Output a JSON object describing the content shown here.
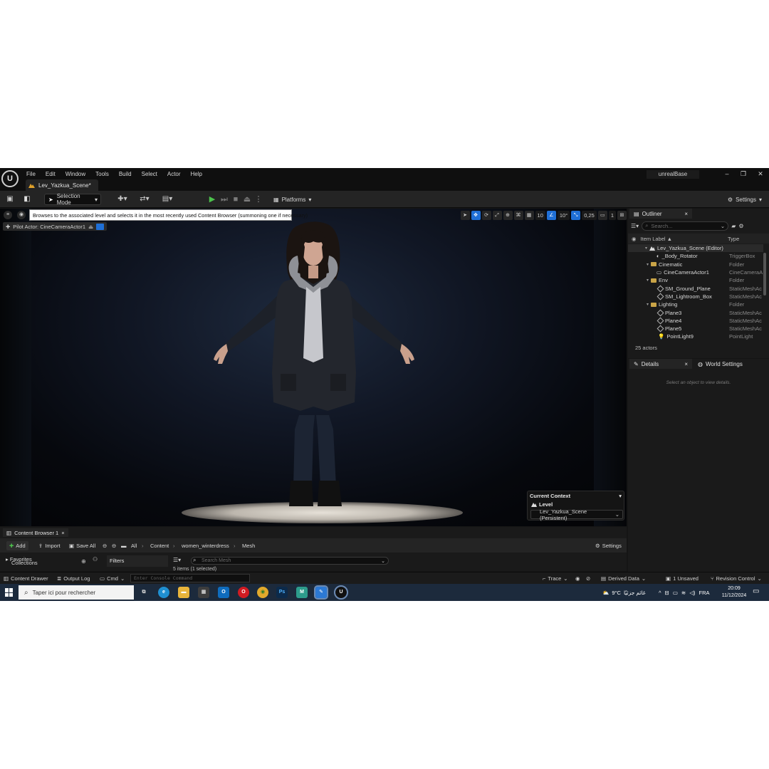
{
  "menu": {
    "items": [
      "File",
      "Edit",
      "Window",
      "Tools",
      "Build",
      "Select",
      "Actor",
      "Help"
    ],
    "doc_tab": "Lev_Yazkua_Scene*",
    "project": "unrealBase"
  },
  "toolbar": {
    "mode": "Selection Mode",
    "platforms": "Platforms",
    "settings": "Settings"
  },
  "viewport": {
    "tooltip": "Browses to the associated level and selects it in the most recently used Content Browser (summoning one if necessary)",
    "pilot": "Pilot Actor: CineCameraActor1",
    "grid_snap": "10",
    "rot_snap": "10°",
    "scale_snap": "0,25",
    "cam_speed": "1"
  },
  "context": {
    "title": "Current Context",
    "level_label": "Level",
    "level_value": "Lev_Yazkua_Scene (Persistent)"
  },
  "outliner": {
    "tab": "Outliner",
    "search_placeholder": "Search...",
    "col_label": "Item Label ▲",
    "col_type": "Type",
    "rows": [
      {
        "label": "Lev_Yazkua_Scene (Editor)",
        "type": ""
      },
      {
        "label": "_Body_Rotator",
        "type": "TriggerBox"
      },
      {
        "label": "Cinematic",
        "type": "Folder"
      },
      {
        "label": "CineCameraActor1",
        "type": "CineCameraA"
      },
      {
        "label": "Env",
        "type": "Folder"
      },
      {
        "label": "SM_Ground_Plane",
        "type": "StaticMeshAc"
      },
      {
        "label": "SM_Lightroom_Box",
        "type": "StaticMeshAc"
      },
      {
        "label": "Lighting",
        "type": "Folder"
      },
      {
        "label": "Plane3",
        "type": "StaticMeshAc"
      },
      {
        "label": "Plane4",
        "type": "StaticMeshAc"
      },
      {
        "label": "Plane5",
        "type": "StaticMeshAc"
      },
      {
        "label": "PointLight9",
        "type": "PointLight"
      }
    ],
    "count": "25 actors"
  },
  "details": {
    "tab": "Details",
    "world_tab": "World Settings",
    "empty": "Select an object to view details."
  },
  "content_browser": {
    "tab": "Content Browser 1",
    "add": "Add",
    "import": "Import",
    "save_all": "Save All",
    "crumbs": [
      "All",
      "Content",
      "women_winterdress",
      "Mesh"
    ],
    "settings": "Settings",
    "favorites": "Favorites",
    "collections": "Collections",
    "filters": "Filters",
    "search_placeholder": "Search Mesh",
    "items": "5 items (1 selected)"
  },
  "statusbar": {
    "drawer": "Content Drawer",
    "output": "Output Log",
    "cmd": "Cmd",
    "console_placeholder": "Enter Console Command",
    "trace": "Trace",
    "derived": "Derived Data",
    "unsaved": "1 Unsaved",
    "revision": "Revision Control"
  },
  "taskbar": {
    "search": "Taper ici pour rechercher",
    "weather": "9°C",
    "weather_text": "غائم جزئيًا",
    "lang": "FRA",
    "time": "20:09",
    "date": "11/12/2024"
  }
}
